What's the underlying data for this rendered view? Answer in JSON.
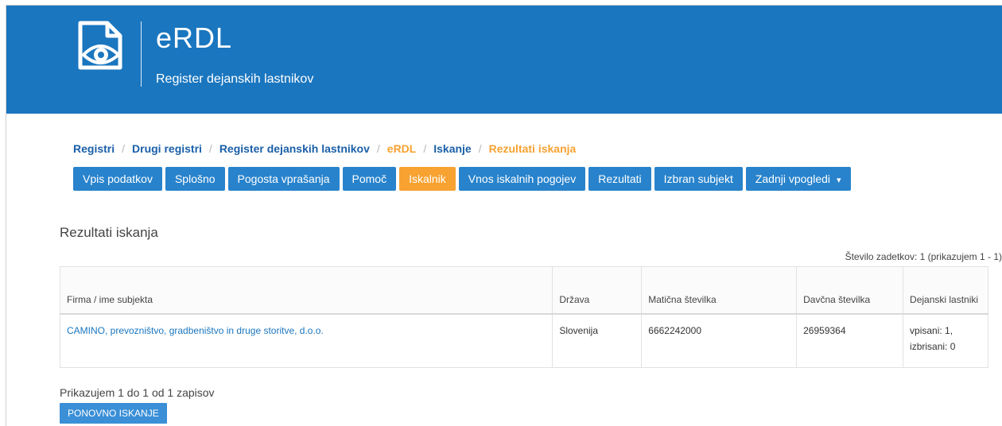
{
  "header": {
    "title": "eRDL",
    "subtitle": "Register dejanskih lastnikov",
    "logo_icon": "document-eye-icon"
  },
  "breadcrumb": {
    "items": [
      "Registri",
      "Drugi registri",
      "Register dejanskih lastnikov",
      "eRDL",
      "Iskanje",
      "Rezultati iskanja"
    ],
    "separator": "/"
  },
  "nav": {
    "items": [
      {
        "label": "Vpis podatkov"
      },
      {
        "label": "Splošno"
      },
      {
        "label": "Pogosta vprašanja"
      },
      {
        "label": "Pomoč"
      },
      {
        "label": "Iskalnik"
      },
      {
        "label": "Vnos iskalnih pogojev"
      },
      {
        "label": "Rezultati"
      },
      {
        "label": "Izbran subjekt"
      },
      {
        "label": "Zadnji vpogledi",
        "chevron": "▾"
      }
    ],
    "active_color": "#f7a231",
    "color": "#2883cc"
  },
  "results": {
    "title": "Rezultati iskanja",
    "count_text": "Število zadetkov: 1 (prikazujem 1 - 1)",
    "columns": [
      "Firma / ime subjekta",
      "Država",
      "Matična številka",
      "Davčna številka",
      "Dejanski lastniki"
    ],
    "rows": [
      {
        "name": "CAMINO, prevozništvo, gradbeništvo in druge storitve, d.o.o.",
        "country": "Slovenija",
        "reg_number": "6662242000",
        "tax_number": "26959364",
        "owners_line1": "vpisani: 1,",
        "owners_line2": "izbrisani: 0"
      }
    ],
    "pager_text": "Prikazujem 1 do 1 od 1 zapisov",
    "again_button": "PONOVNO ISKANJE"
  },
  "colors": {
    "header_bg": "#1a76bf",
    "link": "#1a76bf",
    "accent": "#f7a231"
  }
}
